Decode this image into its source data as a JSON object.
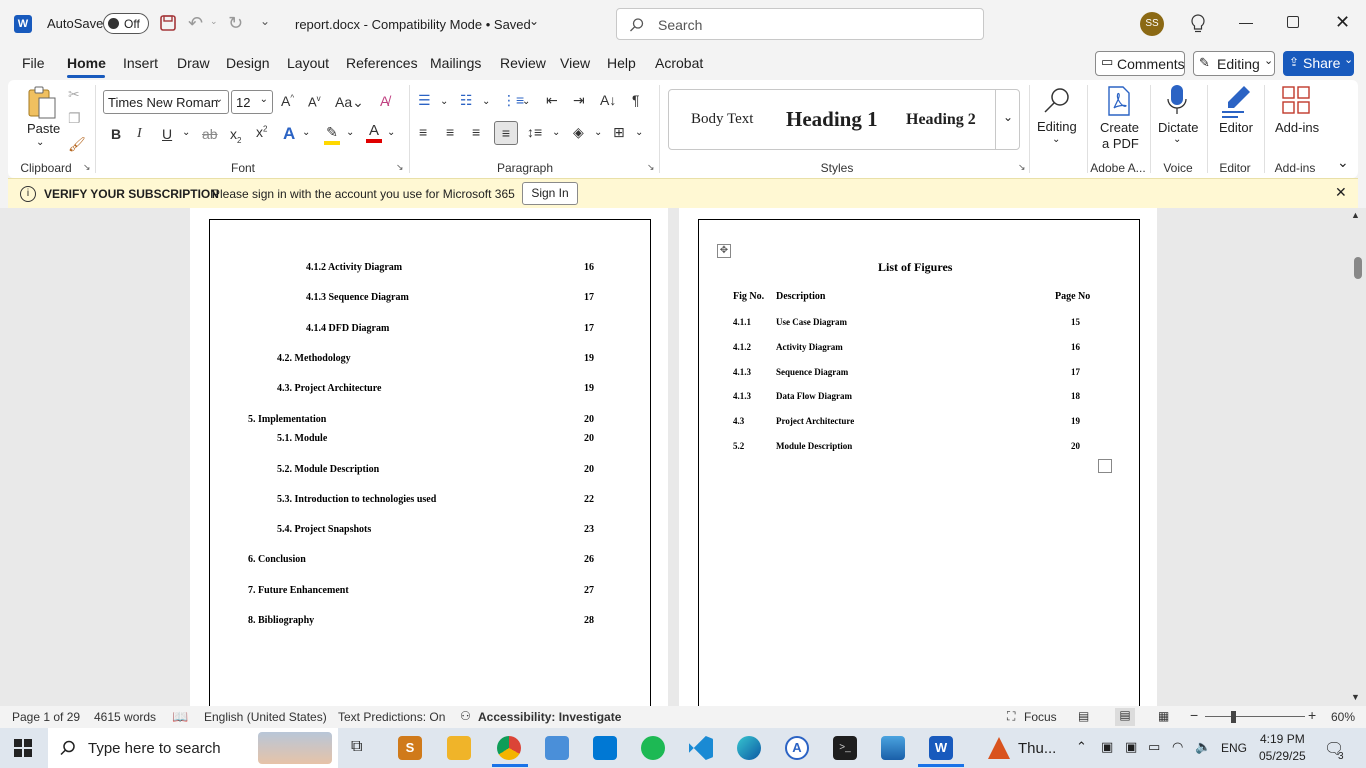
{
  "titlebar": {
    "autosave_label": "AutoSave",
    "autosave_state": "Off",
    "doc_title": "report.docx  -  Compatibility Mode • Saved",
    "search_placeholder": "Search",
    "avatar_initials": "SS"
  },
  "menu": {
    "items": [
      "File",
      "Home",
      "Insert",
      "Draw",
      "Design",
      "Layout",
      "References",
      "Mailings",
      "Review",
      "View",
      "Help",
      "Acrobat"
    ],
    "comments": "Comments",
    "editing": "Editing",
    "share": "Share"
  },
  "ribbon": {
    "paste": "Paste",
    "font_name": "Times New Roman",
    "font_size": "12",
    "styles": [
      "Body Text",
      "Heading 1",
      "Heading 2"
    ],
    "editing": "Editing",
    "create_pdf_1": "Create",
    "create_pdf_2": "a PDF",
    "dictate": "Dictate",
    "editor": "Editor",
    "addins": "Add-ins",
    "group_labels": {
      "clipboard": "Clipboard",
      "font": "Font",
      "paragraph": "Paragraph",
      "styles": "Styles",
      "adobe": "Adobe A...",
      "voice": "Voice",
      "editor": "Editor",
      "addins": "Add-ins"
    }
  },
  "notice": {
    "title": "VERIFY YOUR SUBSCRIPTION",
    "message": "Please sign in with the account you use for Microsoft 365",
    "button": "Sign In"
  },
  "toc": [
    {
      "text": "4.1.2  Activity Diagram",
      "page": "16"
    },
    {
      "text": "4.1.3  Sequence Diagram",
      "page": "17"
    },
    {
      "text": "4.1.4  DFD Diagram",
      "page": "17"
    },
    {
      "text": "4.2.  Methodology",
      "page": "19"
    },
    {
      "text": "4.3.  Project Architecture",
      "page": "19"
    },
    {
      "text": "5. Implementation",
      "page": "20"
    },
    {
      "text": "5.1.  Module",
      "page": "20"
    },
    {
      "text": "5.2.  Module Description",
      "page": "20"
    },
    {
      "text": "5.3.  Introduction to technologies used",
      "page": "22"
    },
    {
      "text": "5.4.  Project Snapshots",
      "page": "23"
    },
    {
      "text": "6. Conclusion",
      "page": "26"
    },
    {
      "text": "7. Future Enhancement",
      "page": "27"
    },
    {
      "text": "8.   Bibliography",
      "page": "28"
    }
  ],
  "figures": {
    "title": "List of Figures",
    "headers": [
      "Fig No.",
      "Description",
      "Page No"
    ],
    "rows": [
      [
        "4.1.1",
        "Use Case Diagram",
        "15"
      ],
      [
        "4.1.2",
        "Activity Diagram",
        "16"
      ],
      [
        "4.1.3",
        "Sequence Diagram",
        "17"
      ],
      [
        "4.1.3",
        "Data Flow Diagram",
        "18"
      ],
      [
        "4.3",
        "Project Architecture",
        "19"
      ],
      [
        "5.2",
        "Module Description",
        "20"
      ]
    ]
  },
  "status": {
    "page": "Page 1 of 29",
    "words": "4615 words",
    "language": "English (United States)",
    "predictions": "Text Predictions: On",
    "accessibility": "Accessibility: Investigate",
    "focus": "Focus",
    "zoom": "60%"
  },
  "taskbar": {
    "search_placeholder": "Type here to search",
    "weather": "Thu...",
    "lang": "ENG",
    "time": "4:19 PM",
    "date": "05/29/25",
    "notif_count": "3"
  },
  "colors": {
    "accent": "#185abd",
    "notice_bg": "#fff8d3"
  }
}
